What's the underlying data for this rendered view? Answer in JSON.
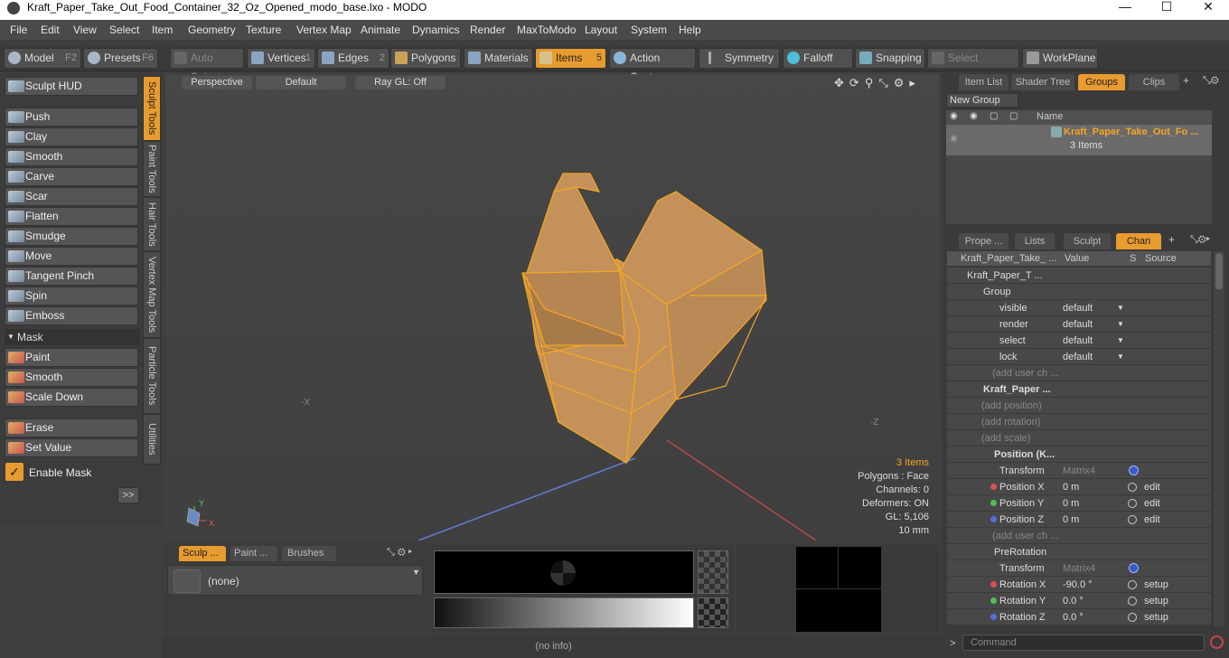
{
  "window": {
    "title": "Kraft_Paper_Take_Out_Food_Container_32_Oz_Opened_modo_base.lxo - MODO"
  },
  "menu": [
    "File",
    "Edit",
    "View",
    "Select",
    "Item",
    "Geometry",
    "Texture",
    "Vertex Map",
    "Animate",
    "Dynamics",
    "Render",
    "MaxToModo",
    "Layout",
    "System",
    "Help"
  ],
  "toolbar": {
    "model": "Model",
    "model_key": "F2",
    "presets": "Presets",
    "presets_key": "F6",
    "auto_select": "Auto Select",
    "vertices": "Vertices",
    "vertices_key": "1",
    "edges": "Edges",
    "edges_key": "2",
    "polygons": "Polygons",
    "materials": "Materials",
    "items": "Items",
    "items_key": "5",
    "action_center": "Action Center",
    "symmetry": "Symmetry",
    "falloff": "Falloff",
    "snapping": "Snapping",
    "select_through": "Select Through",
    "workplane": "WorkPlane"
  },
  "left": {
    "sculpt_hud": "Sculpt HUD",
    "tools": [
      "Push",
      "Clay",
      "Smooth",
      "Carve",
      "Scar",
      "Flatten",
      "Smudge",
      "Move",
      "Tangent Pinch",
      "Spin",
      "Emboss"
    ],
    "mask_header": "Mask",
    "mask_tools": [
      "Paint",
      "Smooth",
      "Scale Down"
    ],
    "erase": "Erase",
    "set_value": "Set Value",
    "enable_mask": "Enable Mask",
    "more": ">>",
    "vtabs": [
      "Sculpt Tools",
      "Paint Tools",
      "Hair Tools",
      "Vertex Map Tools",
      "Particle Tools",
      "Utilities"
    ]
  },
  "viewport": {
    "perspective": "Perspective",
    "default": "Default",
    "raygl": "Ray GL: Off",
    "stats": [
      "3 Items",
      "Polygons : Face",
      "Channels: 0",
      "Deformers: ON",
      "GL: 5,106",
      "10 mm"
    ],
    "axis_x": "-X",
    "axis_z": "-Z",
    "gizmo_y": "Y",
    "gizmo_x": "X"
  },
  "bottom": {
    "tabs": [
      "Sculp ...",
      "Paint ...",
      "Brushes"
    ],
    "none": "(none)"
  },
  "status": "(no info)",
  "right": {
    "tabs_top": [
      "Item List",
      "Shader Tree",
      "Groups",
      "Clips"
    ],
    "new_group": "New Group",
    "name_header": "Name",
    "group_name": "Kraft_Paper_Take_Out_Fo ...",
    "group_count": "3 Items",
    "tabs_mid": [
      "Prope ...",
      "Lists",
      "Sculpt",
      "Chan"
    ],
    "headers": [
      "Kraft_Paper_Take_ ...",
      "Value",
      "S",
      "Source"
    ],
    "rows": [
      {
        "label": "Kraft_Paper_T ...",
        "value": "",
        "src": ""
      },
      {
        "label": "Group",
        "value": "",
        "src": ""
      },
      {
        "label": "visible",
        "value": "default",
        "src": ""
      },
      {
        "label": "render",
        "value": "default",
        "src": ""
      },
      {
        "label": "select",
        "value": "default",
        "src": ""
      },
      {
        "label": "lock",
        "value": "default",
        "src": ""
      },
      {
        "label": "(add user ch ...",
        "value": "",
        "src": ""
      },
      {
        "label": "Kraft_Paper ...",
        "value": "",
        "src": ""
      },
      {
        "label": "(add position)",
        "value": "",
        "src": ""
      },
      {
        "label": "(add rotation)",
        "value": "",
        "src": ""
      },
      {
        "label": "(add scale)",
        "value": "",
        "src": ""
      },
      {
        "label": "Position (K...",
        "value": "",
        "src": ""
      },
      {
        "label": "Transform",
        "value": "Matrix4",
        "src": ""
      },
      {
        "label": "Position X",
        "value": "0 m",
        "src": "edit"
      },
      {
        "label": "Position Y",
        "value": "0 m",
        "src": "edit"
      },
      {
        "label": "Position Z",
        "value": "0 m",
        "src": "edit"
      },
      {
        "label": "(add user ch ...",
        "value": "",
        "src": ""
      },
      {
        "label": "PreRotation",
        "value": "",
        "src": ""
      },
      {
        "label": "Transform",
        "value": "Matrix4",
        "src": ""
      },
      {
        "label": "Rotation X",
        "value": "-90.0 °",
        "src": "setup"
      },
      {
        "label": "Rotation Y",
        "value": "0.0 °",
        "src": "setup"
      },
      {
        "label": "Rotation Z",
        "value": "0.0 °",
        "src": "setup"
      }
    ],
    "command": "Command"
  }
}
